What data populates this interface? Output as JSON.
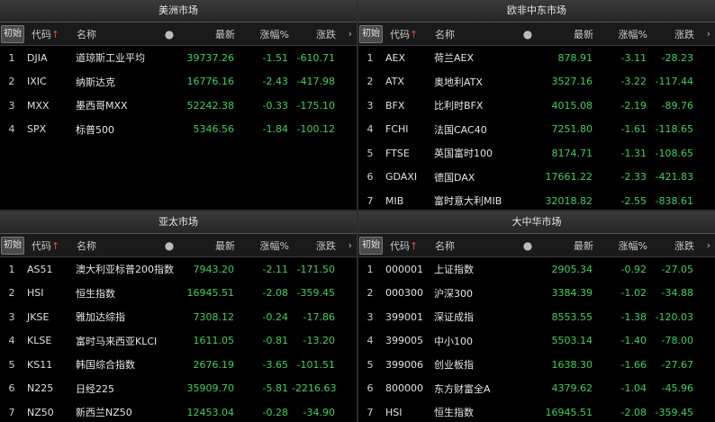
{
  "columns": {
    "init": "初始",
    "code": "代码",
    "code_arrow": "↑",
    "name": "名称",
    "dot": "●",
    "latest": "最新",
    "pct": "涨幅%",
    "chg": "涨跌",
    "more": "›"
  },
  "panels": [
    {
      "title": "美洲市场",
      "rows": [
        {
          "idx": "1",
          "code": "DJIA",
          "name": "道琼斯工业平均",
          "latest": "39737.26",
          "pct": "-1.51",
          "chg": "-610.71"
        },
        {
          "idx": "2",
          "code": "IXIC",
          "name": "纳斯达克",
          "latest": "16776.16",
          "pct": "-2.43",
          "chg": "-417.98"
        },
        {
          "idx": "3",
          "code": "MXX",
          "name": "墨西哥MXX",
          "latest": "52242.38",
          "pct": "-0.33",
          "chg": "-175.10"
        },
        {
          "idx": "4",
          "code": "SPX",
          "name": "标普500",
          "latest": "5346.56",
          "pct": "-1.84",
          "chg": "-100.12"
        }
      ]
    },
    {
      "title": "欧非中东市场",
      "rows": [
        {
          "idx": "1",
          "code": "AEX",
          "name": "荷兰AEX",
          "latest": "878.91",
          "pct": "-3.11",
          "chg": "-28.23"
        },
        {
          "idx": "2",
          "code": "ATX",
          "name": "奥地利ATX",
          "latest": "3527.16",
          "pct": "-3.22",
          "chg": "-117.44"
        },
        {
          "idx": "3",
          "code": "BFX",
          "name": "比利时BFX",
          "latest": "4015.08",
          "pct": "-2.19",
          "chg": "-89.76"
        },
        {
          "idx": "4",
          "code": "FCHI",
          "name": "法国CAC40",
          "latest": "7251.80",
          "pct": "-1.61",
          "chg": "-118.65"
        },
        {
          "idx": "5",
          "code": "FTSE",
          "name": "英国富时100",
          "latest": "8174.71",
          "pct": "-1.31",
          "chg": "-108.65"
        },
        {
          "idx": "6",
          "code": "GDAXI",
          "name": "德国DAX",
          "latest": "17661.22",
          "pct": "-2.33",
          "chg": "-421.83"
        },
        {
          "idx": "7",
          "code": "MIB",
          "name": "富时意大利MIB",
          "latest": "32018.82",
          "pct": "-2.55",
          "chg": "-838.61"
        }
      ]
    },
    {
      "title": "亚太市场",
      "rows": [
        {
          "idx": "1",
          "code": "AS51",
          "name": "澳大利亚标普200指数",
          "latest": "7943.20",
          "pct": "-2.11",
          "chg": "-171.50"
        },
        {
          "idx": "2",
          "code": "HSI",
          "name": "恒生指数",
          "latest": "16945.51",
          "pct": "-2.08",
          "chg": "-359.45"
        },
        {
          "idx": "3",
          "code": "JKSE",
          "name": "雅加达综指",
          "latest": "7308.12",
          "pct": "-0.24",
          "chg": "-17.86"
        },
        {
          "idx": "4",
          "code": "KLSE",
          "name": "富时马来西亚KLCI",
          "latest": "1611.05",
          "pct": "-0.81",
          "chg": "-13.20"
        },
        {
          "idx": "5",
          "code": "KS11",
          "name": "韩国综合指数",
          "latest": "2676.19",
          "pct": "-3.65",
          "chg": "-101.51"
        },
        {
          "idx": "6",
          "code": "N225",
          "name": "日经225",
          "latest": "35909.70",
          "pct": "-5.81",
          "chg": "-2216.63"
        },
        {
          "idx": "7",
          "code": "NZ50",
          "name": "新西兰NZ50",
          "latest": "12453.04",
          "pct": "-0.28",
          "chg": "-34.90"
        }
      ]
    },
    {
      "title": "大中华市场",
      "rows": [
        {
          "idx": "1",
          "code": "000001",
          "name": "上证指数",
          "latest": "2905.34",
          "pct": "-0.92",
          "chg": "-27.05"
        },
        {
          "idx": "2",
          "code": "000300",
          "name": "沪深300",
          "latest": "3384.39",
          "pct": "-1.02",
          "chg": "-34.88"
        },
        {
          "idx": "3",
          "code": "399001",
          "name": "深证成指",
          "latest": "8553.55",
          "pct": "-1.38",
          "chg": "-120.03"
        },
        {
          "idx": "4",
          "code": "399005",
          "name": "中小100",
          "latest": "5503.14",
          "pct": "-1.40",
          "chg": "-78.00"
        },
        {
          "idx": "5",
          "code": "399006",
          "name": "创业板指",
          "latest": "1638.30",
          "pct": "-1.66",
          "chg": "-27.67"
        },
        {
          "idx": "6",
          "code": "800000",
          "name": "东方财富全A",
          "latest": "4379.62",
          "pct": "-1.04",
          "chg": "-45.96"
        },
        {
          "idx": "7",
          "code": "HSI",
          "name": "恒生指数",
          "latest": "16945.51",
          "pct": "-2.08",
          "chg": "-359.45"
        }
      ]
    }
  ]
}
